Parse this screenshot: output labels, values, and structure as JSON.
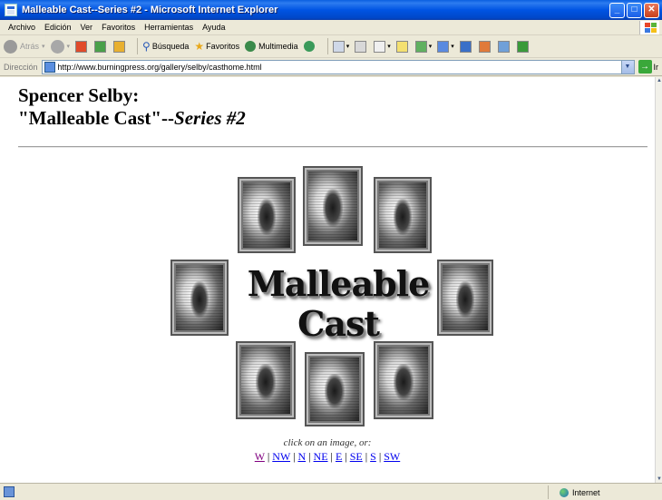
{
  "window": {
    "title": "Malleable Cast--Series #2 - Microsoft Internet Explorer",
    "minimize": "_",
    "maximize": "□",
    "close": "✕"
  },
  "menu": [
    "Archivo",
    "Edición",
    "Ver",
    "Favoritos",
    "Herramientas",
    "Ayuda"
  ],
  "toolbar": {
    "back": "Atrás",
    "search": "Búsqueda",
    "favorites": "Favoritos",
    "media": "Multimedia"
  },
  "address": {
    "label": "Dirección",
    "url": "http://www.burningpress.org/gallery/selby/casthome.html",
    "go": "Ir"
  },
  "page": {
    "author": "Spencer Selby:",
    "title_main": "\"Malleable Cast\"--",
    "title_series": "Series #2",
    "center_line1": "Malleable",
    "center_line2": "Cast",
    "caption": "click on an image, or:",
    "directions": [
      "W",
      "NW",
      "N",
      "NE",
      "E",
      "SE",
      "S",
      "SW"
    ],
    "separator": " | "
  },
  "status": {
    "zone": "Internet"
  }
}
